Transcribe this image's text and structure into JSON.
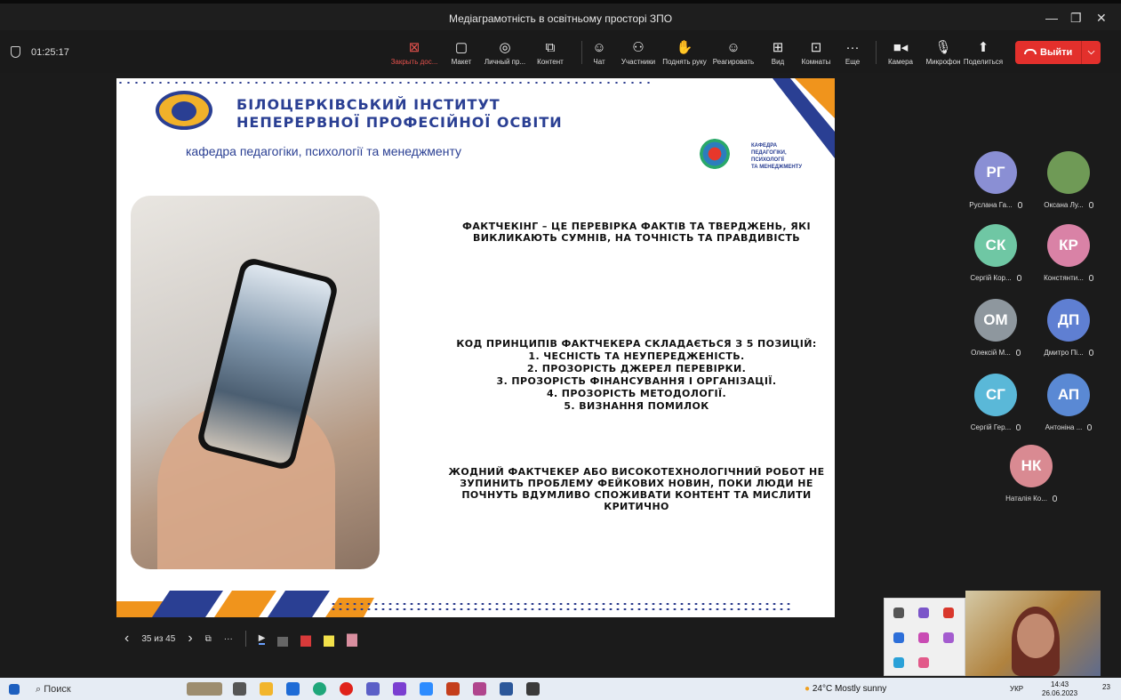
{
  "window": {
    "title": "Медіаграмотність в освітньому просторі ЗПО",
    "min": "—",
    "max": "❐",
    "close": "✕"
  },
  "meeting": {
    "elapsed": "01:25:17"
  },
  "toolbar": {
    "items": [
      {
        "label": "Закрыть дос...",
        "icon": "close-share-icon"
      },
      {
        "label": "Макет",
        "icon": "layout-icon"
      },
      {
        "label": "Личный пр...",
        "icon": "personal-icon"
      },
      {
        "label": "Контент",
        "icon": "content-icon"
      },
      {
        "label": "Чат",
        "icon": "chat-icon"
      },
      {
        "label": "Участники",
        "icon": "participants-icon"
      },
      {
        "label": "Поднять руку",
        "icon": "hand-icon"
      },
      {
        "label": "Реагировать",
        "icon": "smiley-icon"
      },
      {
        "label": "Вид",
        "icon": "view-icon"
      },
      {
        "label": "Комнаты",
        "icon": "rooms-icon"
      },
      {
        "label": "Еще",
        "icon": "more-icon"
      },
      {
        "label": "Камера",
        "icon": "camera-icon"
      },
      {
        "label": "Микрофон",
        "icon": "microphone-icon"
      },
      {
        "label": "Поделиться",
        "icon": "share-icon"
      }
    ],
    "leave_label": "Выйти",
    "accent": "#e3302c"
  },
  "slide": {
    "institute_line1": "БІЛОЦЕРКІВСЬКИЙ ІНСТИТУТ",
    "institute_line2": "НЕПЕРЕРВНОЇ ПРОФЕСІЙНОЇ ОСВІТИ",
    "department": "кафедра педагогіки, психології та менеджменту",
    "dept_logo_text": "КАФЕДРА\nПЕДАГОГІКИ,\nПСИХОЛОГІЇ\nТА МЕНЕДЖМЕНТУ",
    "definition": "Фактчекінг – це перевірка фактів та тверджень, які викликають сумнів, на точність та правдивість",
    "code_title": "Код принципів фактчекера складається з 5 позицій:",
    "code_items": [
      "1. Чесність та неупередженість.",
      "2. Прозорість джерел перевірки.",
      "3. Прозорість фінансування і організації.",
      "4. Прозорість методології.",
      "5. Визнання помилок"
    ],
    "conclusion": "Жодний фактчекер або високотехнологічний робот не зупинить проблему фейкових новин, поки люди не почнуть вдумливо споживати контент та мислити критично",
    "colors": {
      "navy": "#2a3f93",
      "orange": "#f0941c"
    }
  },
  "slide_controls": {
    "counter": "35 из 45",
    "prev": "‹",
    "next": "›",
    "more": "···"
  },
  "participants": [
    {
      "initials": "РГ",
      "name": "Руслана Га...",
      "color": "#8a8fd4"
    },
    {
      "initials": "",
      "name": "Оксана Лу...",
      "color": "#6f9a56"
    },
    {
      "initials": "СК",
      "name": "Сергій Кор...",
      "color": "#6fc7a4"
    },
    {
      "initials": "КР",
      "name": "Констянти...",
      "color": "#d982a6"
    },
    {
      "initials": "ОМ",
      "name": "Олексій М...",
      "color": "#8e979e"
    },
    {
      "initials": "ДП",
      "name": "Дмитро Пі...",
      "color": "#5f7fd2"
    },
    {
      "initials": "СГ",
      "name": "Сергій Гер...",
      "color": "#5ab8d8"
    },
    {
      "initials": "АП",
      "name": "Антоніна ...",
      "color": "#5a89d4"
    },
    {
      "initials": "НК",
      "name": "Наталія Ко...",
      "color": "#d98a92"
    }
  ],
  "taskbar": {
    "search_label": "Поиск",
    "weather": "24°C  Mostly sunny",
    "lang": "УКР",
    "time": "14:43",
    "date": "26.06.2023",
    "notifications": "23"
  }
}
